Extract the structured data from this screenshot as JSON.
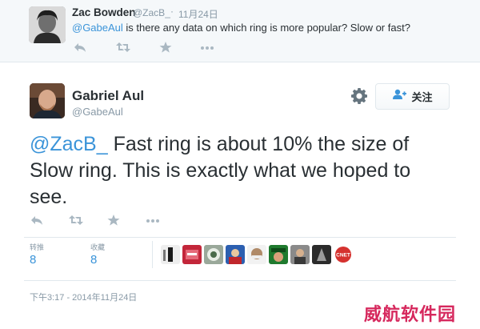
{
  "parent_tweet": {
    "name": "Zac Bowden",
    "handle": "@ZacB_",
    "separator": "·",
    "time": "11月24日",
    "mention": "@GabeAul",
    "text": " is there any data on which ring is more popular? Slow or fast?",
    "actions": [
      "reply-icon",
      "retweet-icon",
      "favorite-icon",
      "more-icon"
    ]
  },
  "main_tweet": {
    "name": "Gabriel Aul",
    "handle": "@GabeAul",
    "follow_label": "关注",
    "mention": "@ZacB_",
    "text": " Fast ring is about 10% the size of Slow ring. This is exactly what we hoped to see.",
    "actions": [
      "reply-icon",
      "retweet-icon",
      "favorite-icon",
      "more-icon"
    ],
    "stats": {
      "retweets_label": "转推",
      "retweets_value": "8",
      "favorites_label": "收藏",
      "favorites_value": "8"
    },
    "timestamp": "下午3:17 - 2014年11月24日"
  },
  "favoriter_avatars_count": 9,
  "favoriter_avatar_text": "CNET",
  "watermark": "威航软件园",
  "colors": {
    "link": "#3b94d9",
    "text": "#292f33",
    "muted": "#8899a6",
    "icon": "#aab8c2",
    "watermark": "#d6285d"
  }
}
